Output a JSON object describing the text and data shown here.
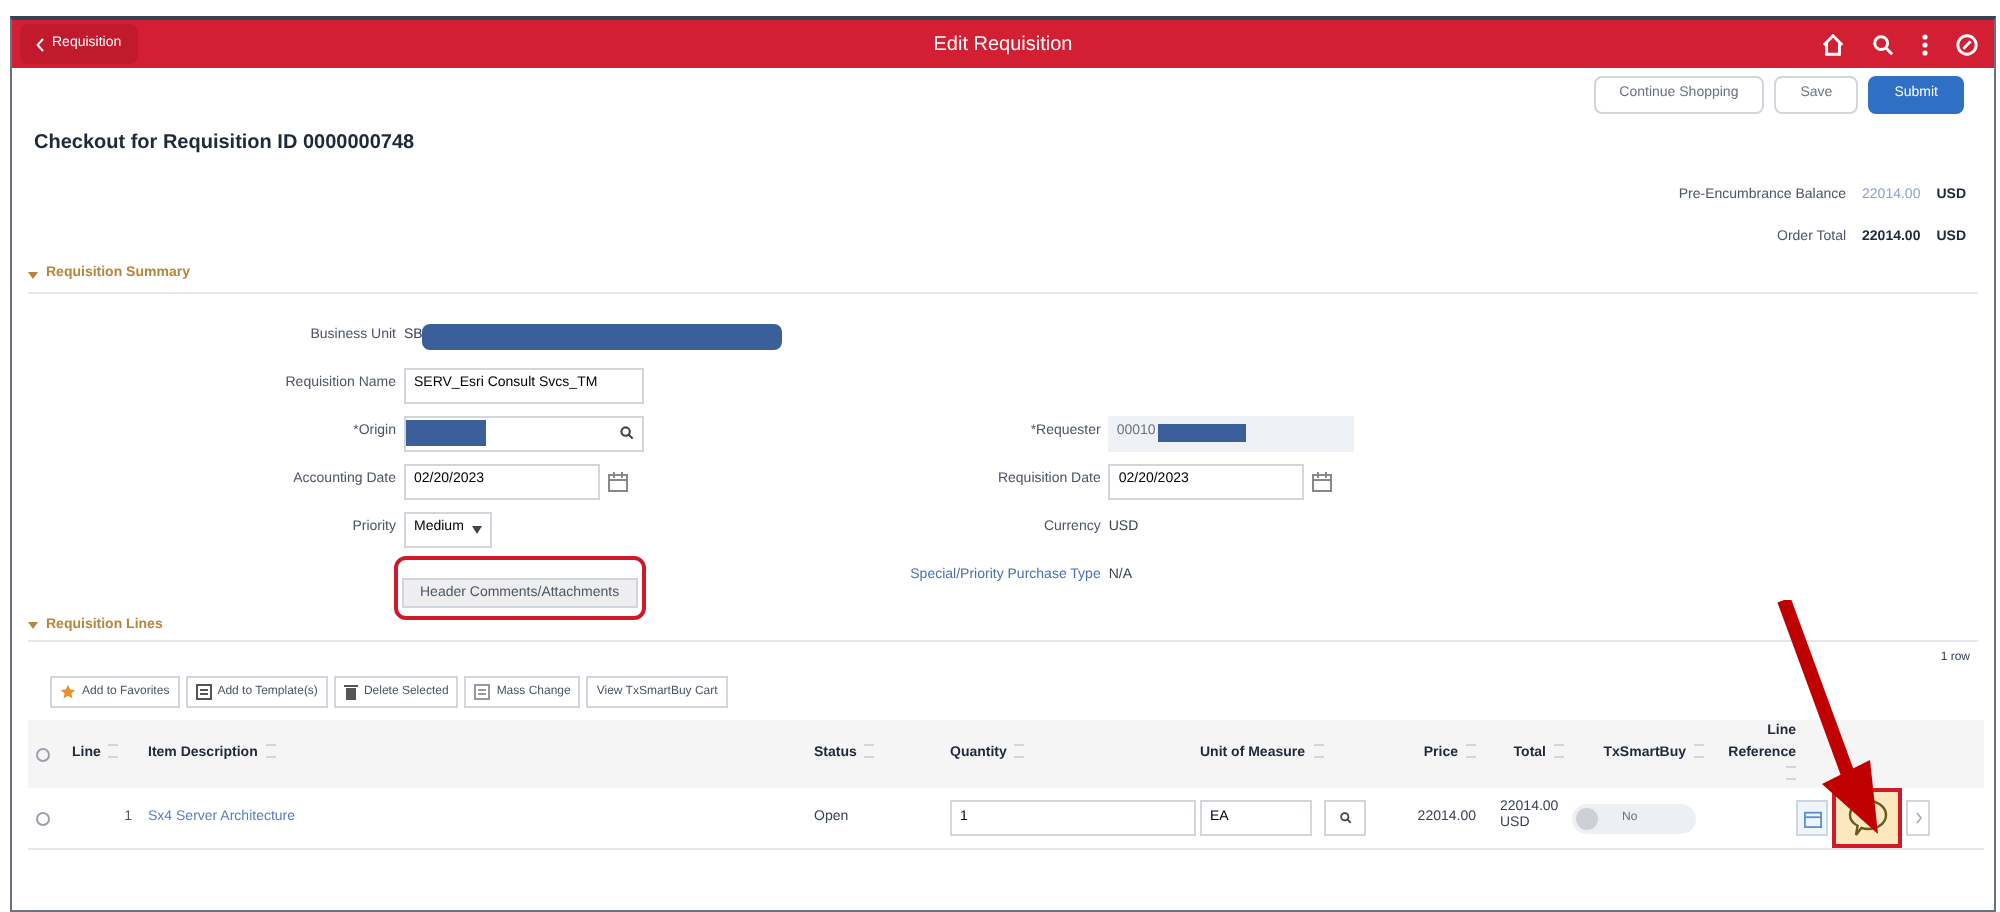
{
  "header": {
    "back_label": "Requisition",
    "title": "Edit Requisition"
  },
  "actions": [
    {
      "label": "Continue Shopping",
      "kind": "secondary"
    },
    {
      "label": "Save",
      "kind": "secondary"
    },
    {
      "label": "Submit",
      "kind": "primary"
    }
  ],
  "page_title": "Checkout for Requisition ID 0000000748",
  "totals": [
    {
      "label": "Pre-Encumbrance Balance",
      "value": "22014.00",
      "kind": "link",
      "currency": "USD"
    },
    {
      "label": "Order Total",
      "value": "22014.00",
      "kind": "bold",
      "currency": "USD"
    }
  ],
  "summary": {
    "title": "Requisition Summary",
    "expanded": true,
    "left_fields": [
      {
        "label": "Business Unit",
        "value": "SB",
        "kind": "redacted_text"
      },
      {
        "label": "Requisition Name",
        "value": "SERV_Esri Consult Svcs_TM",
        "kind": "text"
      },
      {
        "label": "*Origin",
        "kind": "redacted_lookup"
      },
      {
        "label": "Accounting Date",
        "value": "02/20/2023",
        "kind": "date"
      },
      {
        "label": "Priority",
        "value": "Medium",
        "kind": "select"
      }
    ],
    "comments_button": {
      "label": "Header Comments/Attachments",
      "highlighted": true
    },
    "right_fields": [
      {
        "label": "*Requester",
        "value": "00010",
        "kind": "redacted_readonly"
      },
      {
        "label": "Requisition Date",
        "value": "02/20/2023",
        "kind": "date"
      },
      {
        "label": "Currency",
        "value": "USD",
        "kind": "plain"
      },
      {
        "label": "Special/Priority Purchase Type",
        "value": "N/A",
        "kind": "link_label"
      }
    ]
  },
  "lines": {
    "title": "Requisition Lines",
    "expanded": true,
    "row_count": "1 row",
    "toolbar": [
      {
        "label": "Add to Favorites",
        "kind": "favorite"
      },
      {
        "label": "Add to Template(s)",
        "kind": "template"
      },
      {
        "label": "Delete Selected",
        "kind": "delete"
      },
      {
        "label": "Mass Change",
        "kind": "mass"
      },
      {
        "label": "View TxSmartBuy Cart",
        "kind": "text"
      }
    ],
    "all_checked": false,
    "columns": [
      "Line",
      "Item Description",
      "Status",
      "Quantity",
      "Unit of Measure",
      "Price",
      "Total",
      "TxSmartBuy",
      "Line Reference"
    ],
    "rows": [
      {
        "checked": false,
        "line": "1",
        "item": "Sx4 Server Architecture",
        "status": "Open",
        "quantity": "1",
        "uom": "EA",
        "price": "22014.00",
        "total": "22014.00 USD",
        "txsmartbuy": "No",
        "txsmartbuy_on": false,
        "comment_highlighted": true
      }
    ]
  }
}
